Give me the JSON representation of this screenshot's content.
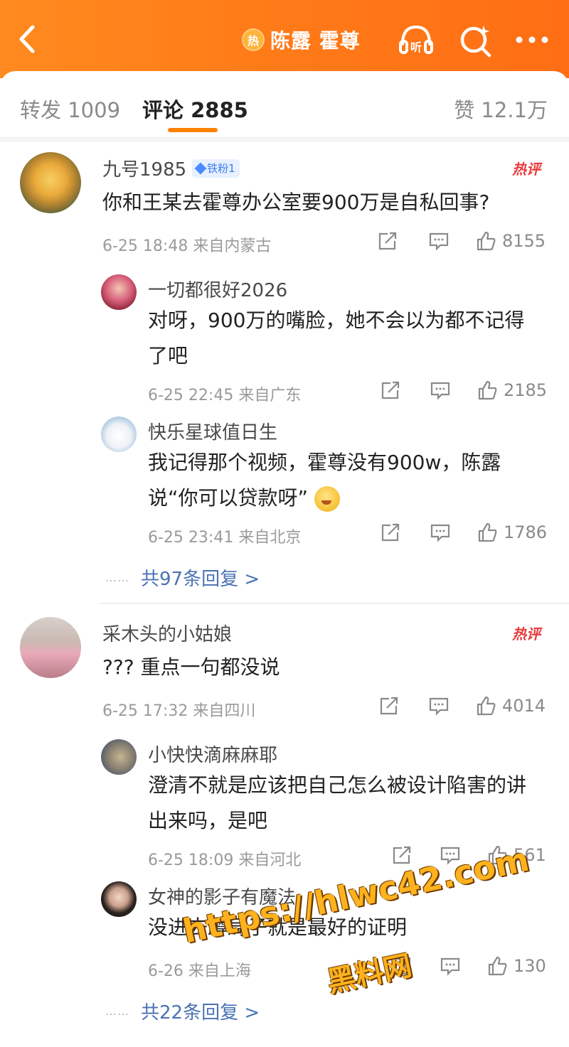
{
  "header": {
    "hot_badge": "热",
    "topic_title": "陈露 霍尊",
    "icons": [
      "back-icon",
      "listen-icon",
      "search-icon",
      "more-icon"
    ],
    "listen_label": "听",
    "colors": {
      "accent": "#ff8200",
      "header_bg": "#ff7a18"
    }
  },
  "tabs": {
    "repost": "转发 1009",
    "comment": "评论 2885",
    "like": "赞 12.1万"
  },
  "comments": [
    {
      "name": "九号1985",
      "badge": "铁粉1",
      "hot_tag": "热评",
      "text": "你和王某去霍尊办公室要900万是自私回事?",
      "meta": "6-25 18:48 来自内蒙古",
      "likes": "8155",
      "replies": [
        {
          "name": "一切都很好2026",
          "text": "对呀，900万的嘴脸，她不会以为都不记得了吧",
          "meta": "6-25 22:45 来自广东",
          "likes": "2185"
        },
        {
          "name": "快乐星球值日生",
          "text": "我记得那个视频，霍尊没有900w，陈露说“你可以贷款呀”",
          "meta": "6-25 23:41 来自北京",
          "likes": "1786"
        }
      ],
      "more_replies": "共97条回复 >"
    },
    {
      "name": "采木头的小姑娘",
      "hot_tag": "热评",
      "text": "??? 重点一句都没说",
      "meta": "6-25 17:32 来自四川",
      "likes": "4014",
      "replies": [
        {
          "name": "小快快滴麻麻耶",
          "text": "澄清不就是应该把自己怎么被设计陷害的讲出来吗，是吧",
          "meta": "6-25 18:09 来自河北",
          "likes": "561"
        },
        {
          "name": "女神的影子有魔法",
          "text": "没进去蹲局子就是最好的证明",
          "meta": "6-26 来自上海",
          "likes": "130"
        }
      ],
      "more_replies": "共22条回复 >"
    }
  ],
  "dots": "……",
  "watermark": {
    "url": "https://hlwc42.com",
    "name": "黑料网"
  }
}
